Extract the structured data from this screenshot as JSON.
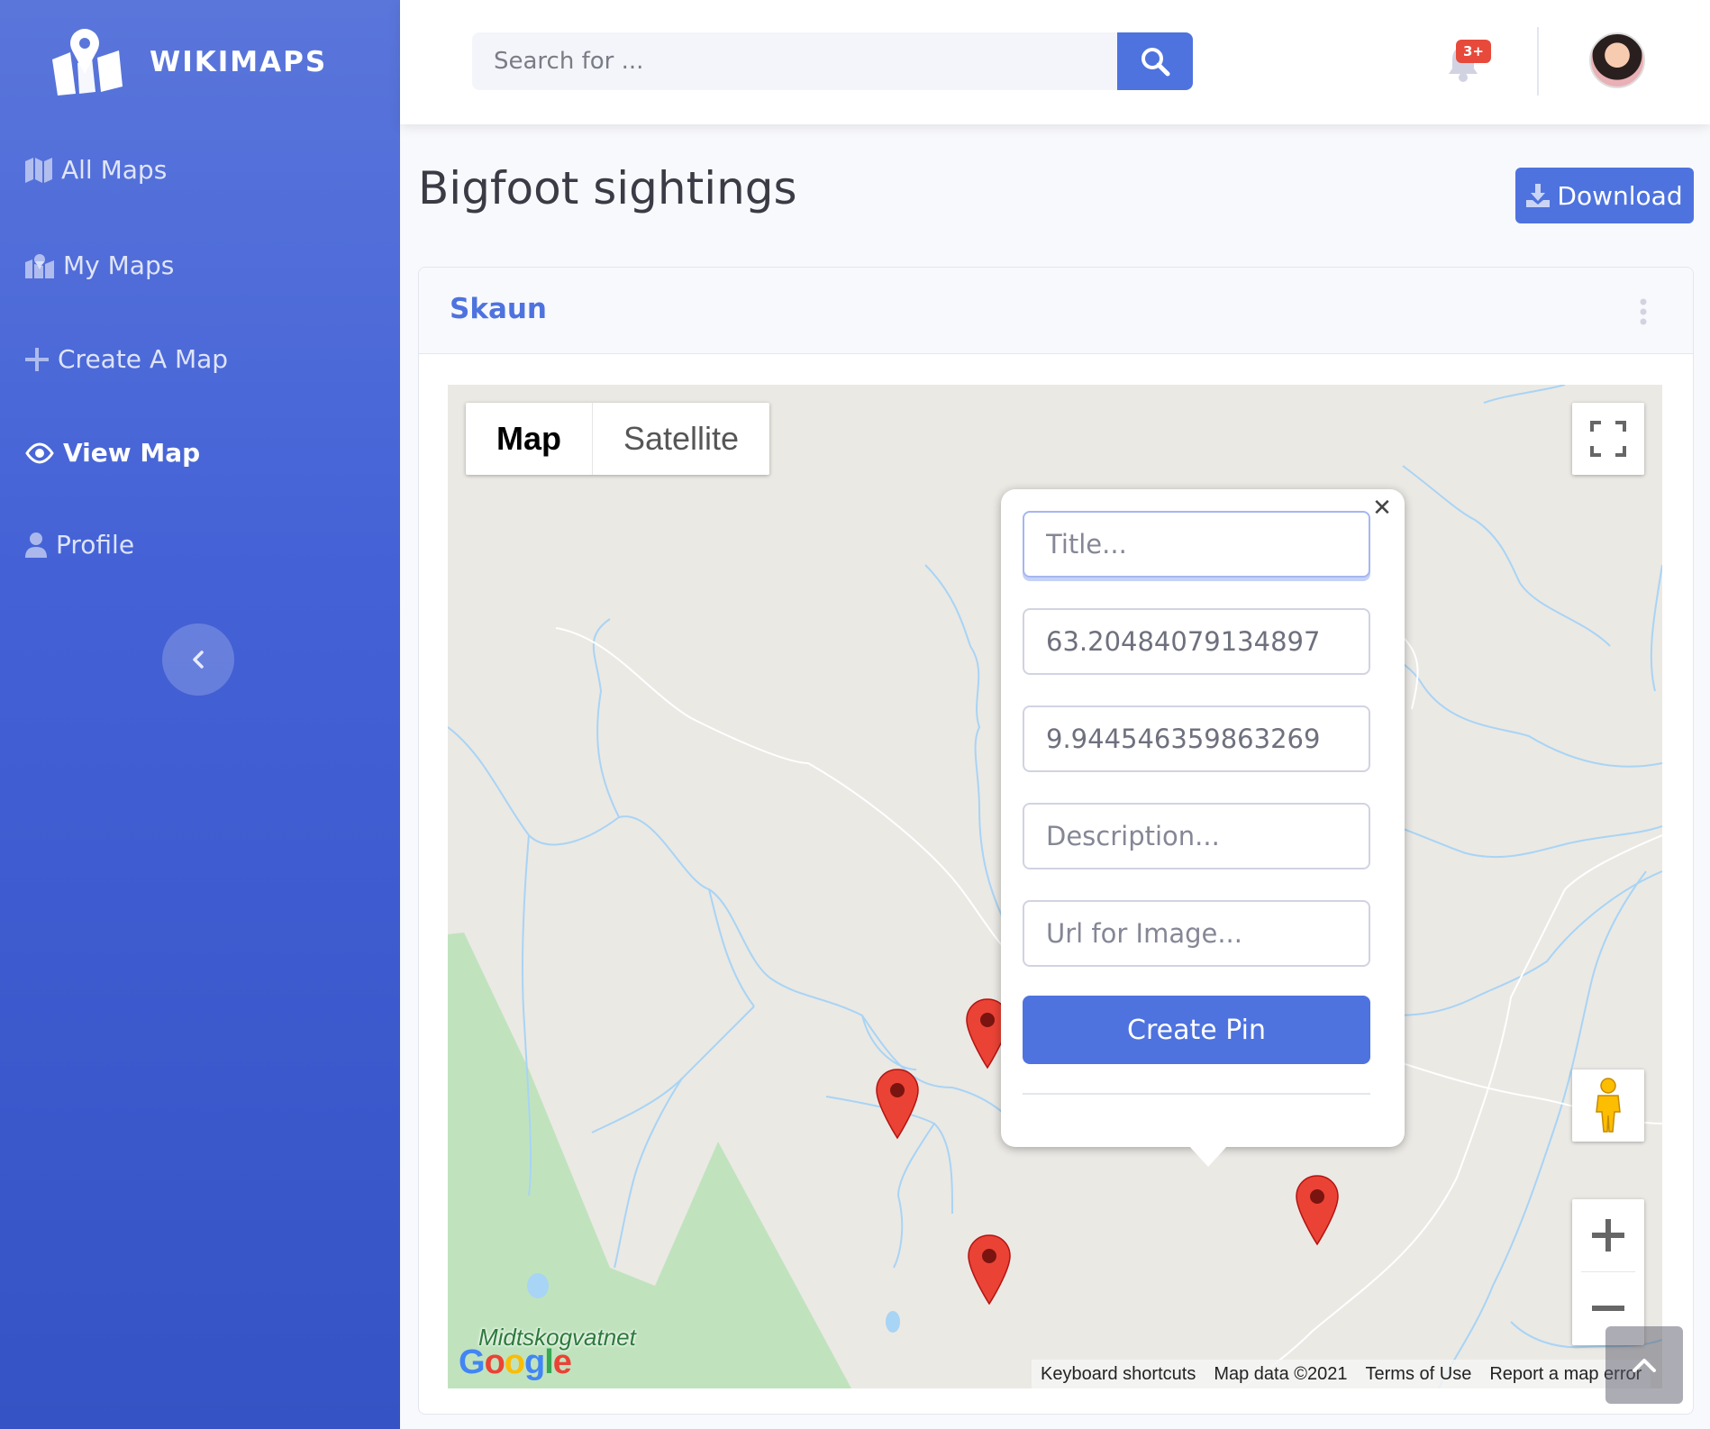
{
  "brand": {
    "name": "WIKIMAPS"
  },
  "sidebar": {
    "items": [
      {
        "label": "All Maps",
        "icon": "map-icon",
        "active": false
      },
      {
        "label": "My Maps",
        "icon": "map-marked-icon",
        "active": false
      },
      {
        "label": "Create A Map",
        "icon": "plus-icon",
        "active": false
      },
      {
        "label": "View Map",
        "icon": "eye-icon",
        "active": true
      },
      {
        "label": "Profile",
        "icon": "user-icon",
        "active": false
      }
    ],
    "collapse_icon": "chevron-left-icon"
  },
  "topbar": {
    "search_placeholder": "Search for ...",
    "notifications_badge": "3+"
  },
  "page": {
    "title": "Bigfoot sightings",
    "download_label": "Download"
  },
  "card": {
    "title": "Skaun"
  },
  "map": {
    "type_buttons": {
      "map": "Map",
      "satellite": "Satellite"
    },
    "selected_type": "Map",
    "place_label": "Midtskogvatnet",
    "google_logo": "Google",
    "footer": {
      "shortcuts": "Keyboard shortcuts",
      "map_data": "Map data ©2021",
      "terms": "Terms of Use",
      "report": "Report a map error"
    }
  },
  "info_window": {
    "title_placeholder": "Title...",
    "latitude": "63.20484079134897",
    "longitude": "9.944546359863269",
    "description_placeholder": "Description...",
    "image_url_placeholder": "Url for Image...",
    "create_label": "Create Pin",
    "close_glyph": "✕"
  },
  "colors": {
    "primary": "#4e73df",
    "sidebar_top": "#5a76db",
    "sidebar_bottom": "#3553c4",
    "danger": "#e74a3b",
    "pin": "#ea4335",
    "water": "#a8d4f5",
    "park": "#c0e3be"
  }
}
